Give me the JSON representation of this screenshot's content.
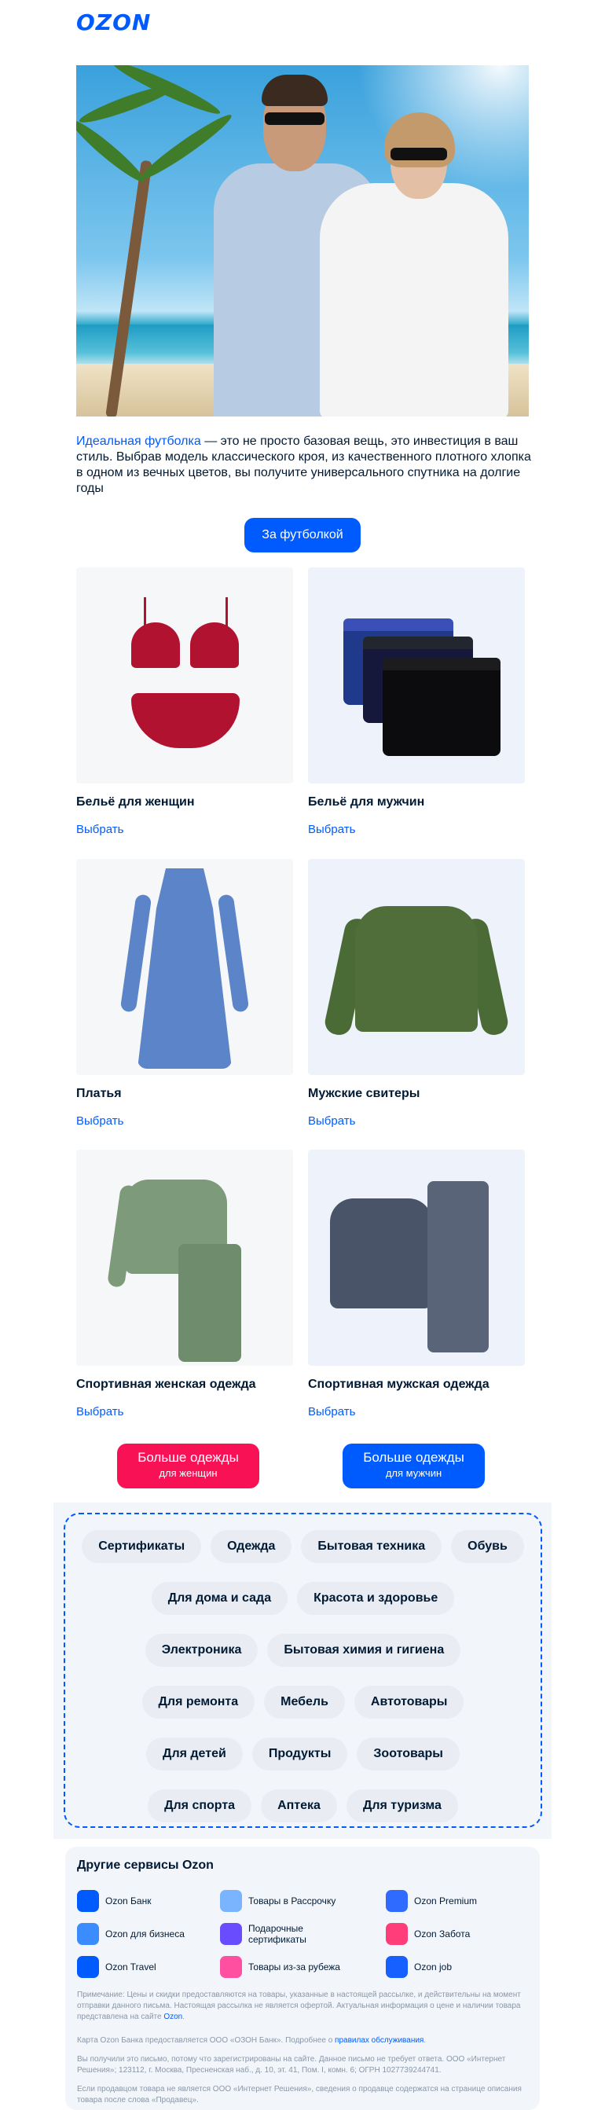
{
  "header": {
    "logo": "OZON"
  },
  "intro": {
    "link_text": "Идеальная футболка",
    "text": " — это не просто базовая вещь, это инвестиция в ваш стиль. Выбрав модель классического кроя, из качественного плотного хлопка в одном из вечных цветов, вы получите универсального спутника на долгие годы"
  },
  "cta_main": "За футболкой",
  "products": [
    {
      "title": "Бельё для женщин",
      "action": "Выбрать"
    },
    {
      "title": "Бельё для мужчин",
      "action": "Выбрать"
    },
    {
      "title": "Платья",
      "action": "Выбрать"
    },
    {
      "title": "Мужские свитеры",
      "action": "Выбрать"
    },
    {
      "title": "Спортивная женская одежда",
      "action": "Выбрать"
    },
    {
      "title": "Спортивная мужская одежда",
      "action": "Выбрать"
    }
  ],
  "more_buttons": {
    "women": {
      "line1": "Больше одежды",
      "line2": "для женщин"
    },
    "men": {
      "line1": "Больше одежды",
      "line2": "для мужчин"
    }
  },
  "categories": [
    [
      "Сертификаты",
      "Одежда",
      "Бытовая техника",
      "Обувь"
    ],
    [
      "Для дома и сада",
      "Красота и здоровье"
    ],
    [
      "Электроника",
      "Бытовая химия и гигиена"
    ],
    [
      "Для ремонта",
      "Мебель",
      "Автотовары"
    ],
    [
      "Для детей",
      "Продукты",
      "Зоотовары"
    ],
    [
      "Для спорта",
      "Аптека",
      "Для туризма"
    ]
  ],
  "services": {
    "title": "Другие сервисы Ozon",
    "items": [
      {
        "label": "Ozon Банк",
        "icon": "bank-icon",
        "color": "#005bff"
      },
      {
        "label": "Товары в Рассрочку",
        "icon": "installment-icon",
        "color": "#7ab4ff"
      },
      {
        "label": "Ozon Premium",
        "icon": "premium-icon",
        "color": "#2f6bff"
      },
      {
        "label": "Ozon для бизнеса",
        "icon": "business-icon",
        "color": "#3b8cff"
      },
      {
        "label": "Подарочные сертификаты",
        "icon": "gift-icon",
        "color": "#6a4cff"
      },
      {
        "label": "Ozon Забота",
        "icon": "care-icon",
        "color": "#ff3d7a"
      },
      {
        "label": "Ozon Travel",
        "icon": "travel-icon",
        "color": "#005bff"
      },
      {
        "label": "Товары из-за рубежа",
        "icon": "abroad-icon",
        "color": "#ff4fa0"
      },
      {
        "label": "Ozon job",
        "icon": "job-icon",
        "color": "#1560ff"
      }
    ],
    "note1": "Примечание: Цены и скидки предоставляются на товары, указанные в настоящей рассылке, и действительны на момент отправки данного письма. Настоящая рассылка не является офертой. Актуальная информация о цене и наличии товара представлена на сайте ",
    "note1_link": "Ozon",
    "note2": "Карта Ozon Банка предоставляется ООО «ОЗОН Банк». Подробнее о ",
    "note2_link": "правилах обслуживания",
    "note3": "Вы получили это письмо, потому что зарегистрированы на сайте. Данное письмо не требует ответа. ООО «Интернет Решения»; 123112, г. Москва, Пресненская наб., д. 10, эт. 41, Пом. I, комн. 6; ОГРН 1027739244741.",
    "note4": "Если продавцом товара не является ООО «Интернет Решения», сведения о продавце содержатся на странице описания товара после слова «Продавец»."
  }
}
